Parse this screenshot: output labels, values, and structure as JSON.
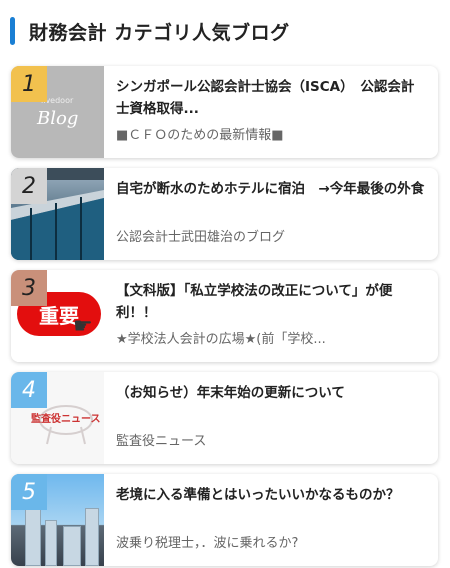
{
  "header": {
    "title": "財務会計 カテゴリ人気ブログ"
  },
  "items": [
    {
      "rank": "1",
      "title": "シンガポール公認会計士協会（ISCA）　公認会計士資格取得...",
      "source": "■ＣＦＯのための最新情報■",
      "thumb": {
        "icon": "livedoor-blog-logo",
        "small": "livedoor",
        "big": "Blog"
      }
    },
    {
      "rank": "2",
      "title": "自宅が断水のためホテルに宿泊　→今年最後の外食",
      "source": "公認会計士武田雄治のブログ",
      "thumb": {
        "icon": "hotel-pool-photo"
      }
    },
    {
      "rank": "3",
      "title": "【文科版】「私立学校法の改正について」が便利！！",
      "source": "★学校法人会計の広場★(前「学校...",
      "thumb": {
        "icon": "important-badge-image",
        "badge": "重要"
      }
    },
    {
      "rank": "4",
      "title": "（お知らせ）年末年始の更新について",
      "source": "監査役ニュース",
      "thumb": {
        "icon": "auditor-news-logo",
        "text": "監査役ニュース"
      }
    },
    {
      "rank": "5",
      "title": "老境に入る準備とはいったいいかなるものか？",
      "source": "波乗り税理士，．波に乗れるか?",
      "thumb": {
        "icon": "city-skyline-photo"
      }
    }
  ]
}
